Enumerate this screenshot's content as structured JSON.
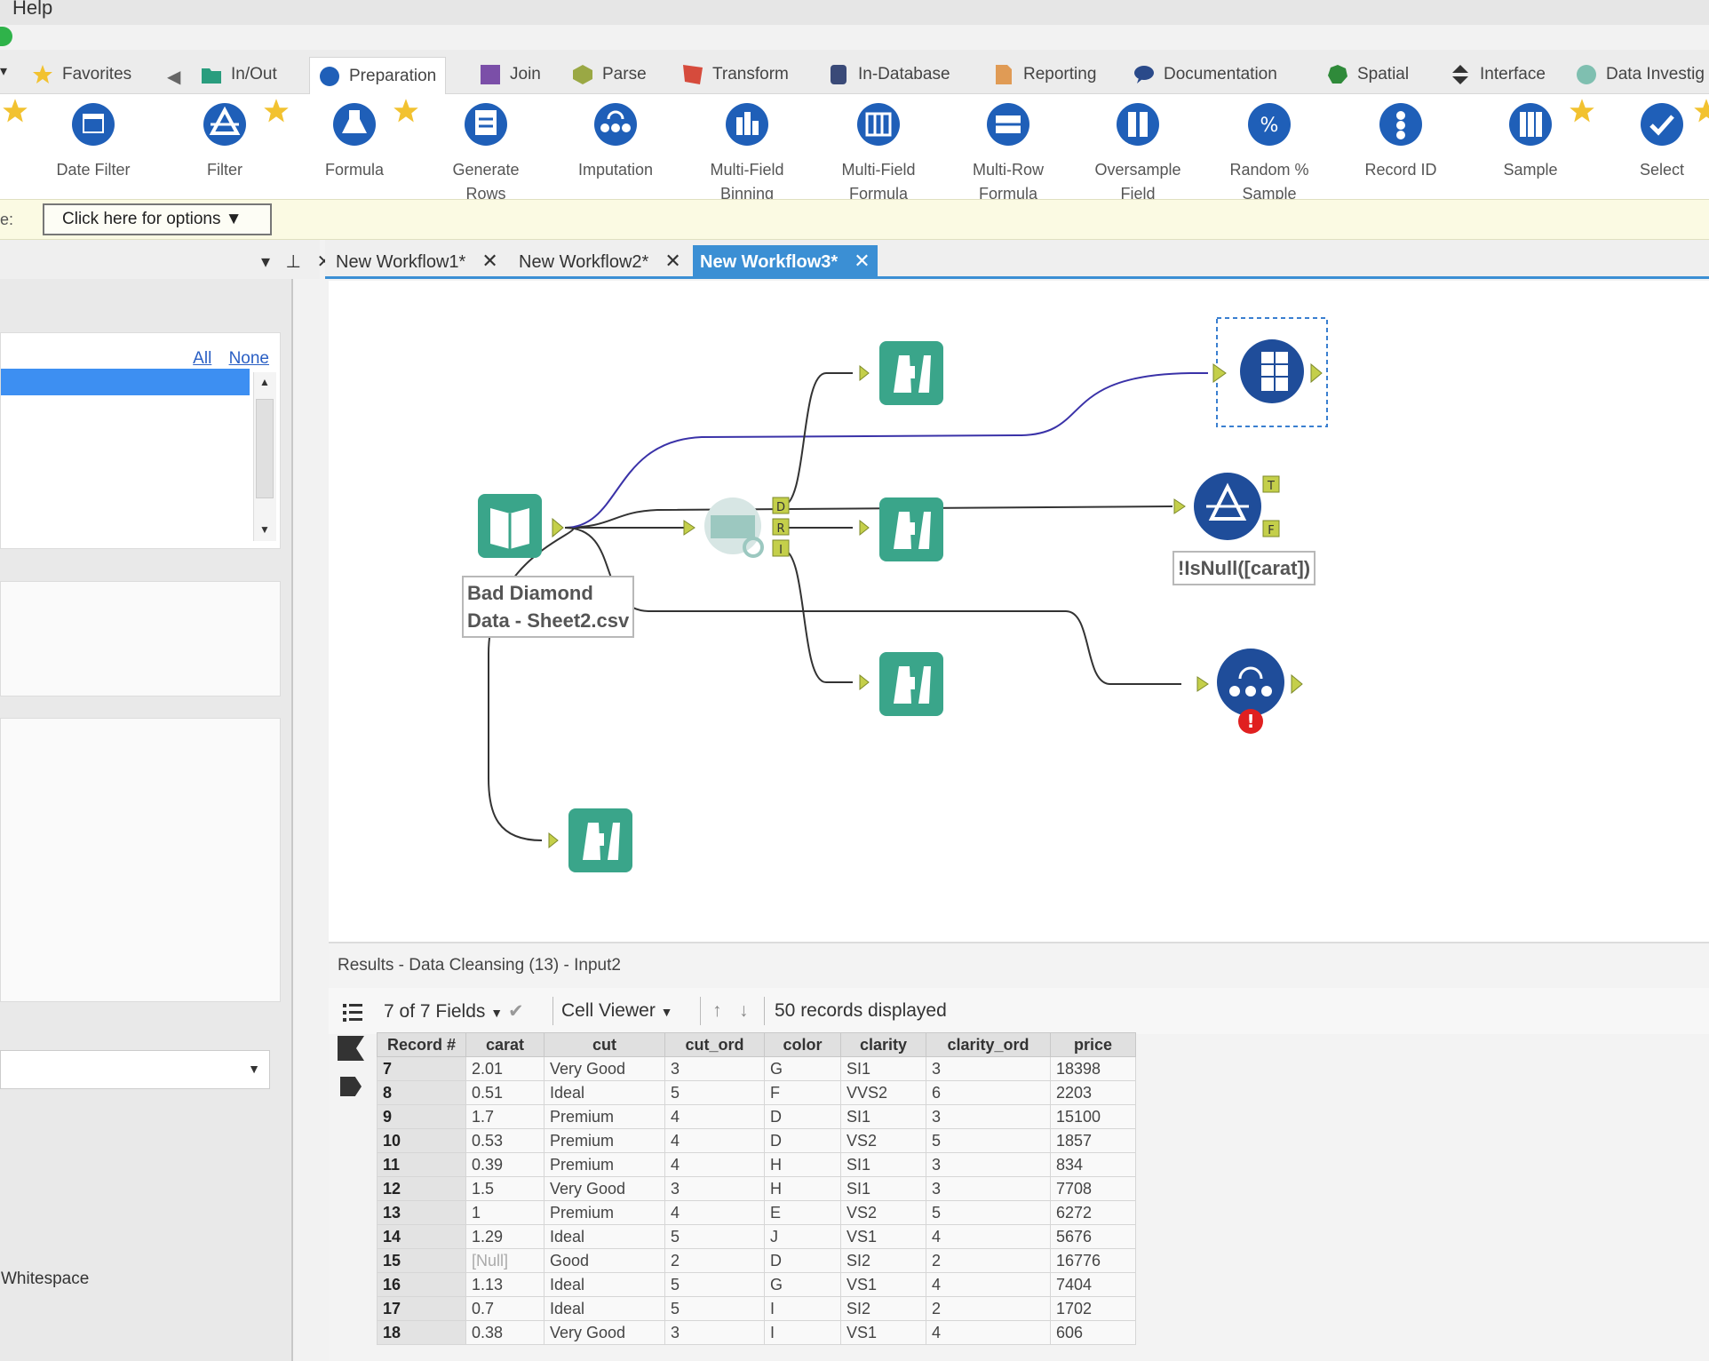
{
  "menu": {
    "help": "Help"
  },
  "category_tabs": [
    {
      "label": "Favorites",
      "color": "#f2c230"
    },
    {
      "label": "In/Out",
      "color": "#2a9d7e"
    },
    {
      "label": "Preparation",
      "color": "#1f5fb8"
    },
    {
      "label": "Join",
      "color": "#7b4fa8"
    },
    {
      "label": "Parse",
      "color": "#9aa844"
    },
    {
      "label": "Transform",
      "color": "#d64b3c"
    },
    {
      "label": "In-Database",
      "color": "#3a4a78"
    },
    {
      "label": "Reporting",
      "color": "#e09b55"
    },
    {
      "label": "Documentation",
      "color": "#2a4a8a"
    },
    {
      "label": "Spatial",
      "color": "#2f8a3a"
    },
    {
      "label": "Interface",
      "color": "#333333"
    },
    {
      "label": "Data Investig",
      "color": "#7fbfb0"
    }
  ],
  "active_category": "Preparation",
  "tools": [
    {
      "line1": "Date Filter",
      "line2": "",
      "icon": "date-filter-icon"
    },
    {
      "line1": "Filter",
      "line2": "",
      "icon": "filter-icon"
    },
    {
      "line1": "Formula",
      "line2": "",
      "icon": "formula-icon"
    },
    {
      "line1": "Generate",
      "line2": "Rows",
      "icon": "generate-rows-icon"
    },
    {
      "line1": "Imputation",
      "line2": "",
      "icon": "imputation-icon"
    },
    {
      "line1": "Multi-Field",
      "line2": "Binning",
      "icon": "multi-field-binning-icon"
    },
    {
      "line1": "Multi-Field",
      "line2": "Formula",
      "icon": "multi-field-formula-icon"
    },
    {
      "line1": "Multi-Row",
      "line2": "Formula",
      "icon": "multi-row-formula-icon"
    },
    {
      "line1": "Oversample",
      "line2": "Field",
      "icon": "oversample-field-icon"
    },
    {
      "line1": "Random %",
      "line2": "Sample",
      "icon": "random-sample-icon"
    },
    {
      "line1": "Record ID",
      "line2": "",
      "icon": "record-id-icon"
    },
    {
      "line1": "Sample",
      "line2": "",
      "icon": "sample-icon"
    },
    {
      "line1": "Select",
      "line2": "",
      "icon": "select-icon"
    }
  ],
  "options_bar": {
    "label": "e:",
    "button": "Click here for options ▼"
  },
  "left_panel": {
    "controls": "▾ ⊥ ✕",
    "link_all": "All",
    "link_none": "None",
    "whitespace_text": "Whitespace"
  },
  "doc_tabs": [
    {
      "label": "New Workflow1*",
      "close": "✕"
    },
    {
      "label": "New Workflow2*",
      "close": "✕"
    },
    {
      "label": "New Workflow3*",
      "close": "✕"
    }
  ],
  "canvas": {
    "input_label_line1": "Bad Diamond",
    "input_label_line2": "Data - Sheet2.csv",
    "filter_annotation": "!IsNull([carat])",
    "anchor_d": "D",
    "anchor_r": "R",
    "anchor_i": "I",
    "anchor_t": "T",
    "anchor_f": "F",
    "error_mark": "!"
  },
  "results": {
    "title": "Results - Data Cleansing (13) - Input2",
    "fields": "7 of 7 Fields",
    "viewer": "Cell Viewer",
    "count": "50 records displayed",
    "headers": [
      "Record #",
      "carat",
      "cut",
      "cut_ord",
      "color",
      "clarity",
      "clarity_ord",
      "price"
    ],
    "rows": [
      [
        "7",
        "2.01",
        "Very Good",
        "3",
        "G",
        "SI1",
        "3",
        "18398"
      ],
      [
        "8",
        "0.51",
        "Ideal",
        "5",
        "F",
        "VVS2",
        "6",
        "2203"
      ],
      [
        "9",
        "1.7",
        "Premium",
        "4",
        "D",
        "SI1",
        "3",
        "15100"
      ],
      [
        "10",
        "0.53",
        "Premium",
        "4",
        "D",
        "VS2",
        "5",
        "1857"
      ],
      [
        "11",
        "0.39",
        "Premium",
        "4",
        "H",
        "SI1",
        "3",
        "834"
      ],
      [
        "12",
        "1.5",
        "Very Good",
        "3",
        "H",
        "SI1",
        "3",
        "7708"
      ],
      [
        "13",
        "1",
        "Premium",
        "4",
        "E",
        "VS2",
        "5",
        "6272"
      ],
      [
        "14",
        "1.29",
        "Ideal",
        "5",
        "J",
        "VS1",
        "4",
        "5676"
      ],
      [
        "15",
        "[Null]",
        "Good",
        "2",
        "D",
        "SI2",
        "2",
        "16776"
      ],
      [
        "16",
        "1.13",
        "Ideal",
        "5",
        "G",
        "VS1",
        "4",
        "7404"
      ],
      [
        "17",
        "0.7",
        "Ideal",
        "5",
        "I",
        "SI2",
        "2",
        "1702"
      ],
      [
        "18",
        "0.38",
        "Very Good",
        "3",
        "I",
        "VS1",
        "4",
        "606"
      ]
    ]
  }
}
